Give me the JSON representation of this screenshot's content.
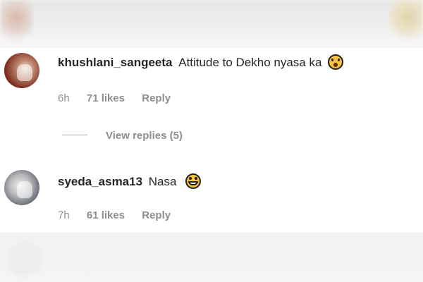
{
  "comments": [
    {
      "username": "khushlani_sangeeta",
      "text": "Attitude to Dekho nyasa ka",
      "emoji": "astonished-face-icon",
      "time": "6h",
      "likes": "71 likes",
      "reply_label": "Reply",
      "view_replies": "View replies (5)"
    },
    {
      "username": "syeda_asma13",
      "text": "Nasa",
      "emoji": "grinning-face-icon",
      "time": "7h",
      "likes": "61 likes",
      "reply_label": "Reply"
    }
  ],
  "colors": {
    "text_primary": "#262626",
    "text_secondary": "#8e8e8e",
    "background": "#ffffff"
  }
}
